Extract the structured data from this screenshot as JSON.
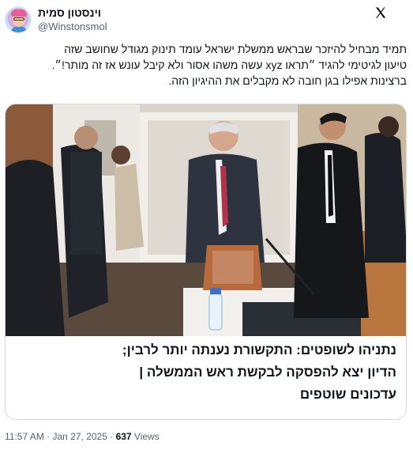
{
  "author": {
    "display_name": "וינסטון סמית",
    "handle": "@Winstonsmol"
  },
  "icons": {
    "platform_logo": "x-logo-icon",
    "avatar": "avatar-illustration"
  },
  "tweet": {
    "lines": [
      "תמיד מבחיל להיזכר שבראש ממשלת ישראל עומד תינוק מגודל שחושב שזה",
      "טיעון לגיטימי להגיד ״תראו xyz עשה משהו אסור ולא קיבל עונש אז זה מותר!״.",
      "ברצינות אפילו בגן חובה לא מקבלים את ההיגיון הזה."
    ]
  },
  "card": {
    "headline_lines": [
      "נתניהו לשופטים: התקשורת נענתה יותר לרבין;",
      "הדיון יצא להפסקה לבקשת ראש הממשלה |",
      "עדכונים שוטפים"
    ]
  },
  "footer": {
    "time": "11:57 AM",
    "date": "Jan 27, 2025",
    "separator": " · ",
    "views_count": "637",
    "views_label": " Views"
  }
}
